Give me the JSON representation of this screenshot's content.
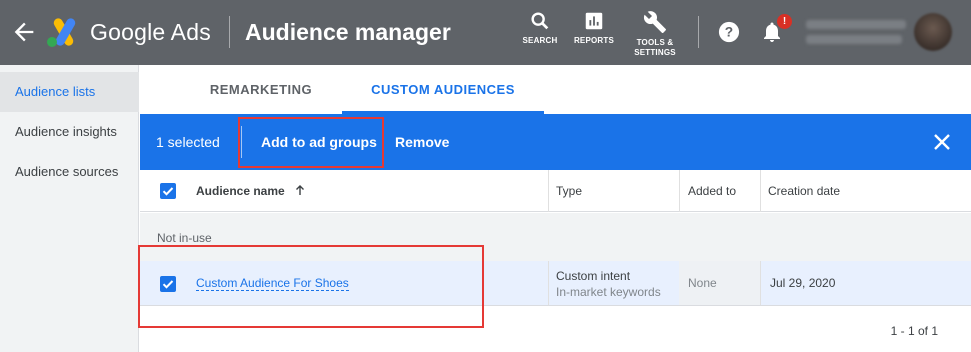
{
  "header": {
    "brand": "Google Ads",
    "page_title": "Audience manager",
    "tools": [
      {
        "icon": "search-icon",
        "label": "SEARCH"
      },
      {
        "icon": "reports-icon",
        "label": "REPORTS"
      },
      {
        "icon": "wrench-icon",
        "label_line1": "TOOLS &",
        "label_line2": "SETTINGS"
      }
    ],
    "notification_badge": "!"
  },
  "sidebar": {
    "items": [
      {
        "label": "Audience lists",
        "active": true
      },
      {
        "label": "Audience insights",
        "active": false
      },
      {
        "label": "Audience sources",
        "active": false
      }
    ]
  },
  "tabs": [
    {
      "label": "REMARKETING",
      "active": false
    },
    {
      "label": "CUSTOM AUDIENCES",
      "active": true
    }
  ],
  "selection_bar": {
    "count_text": "1 selected",
    "add_label": "Add to ad groups",
    "remove_label": "Remove"
  },
  "table": {
    "columns": {
      "name": "Audience name",
      "type": "Type",
      "added": "Added to",
      "date": "Creation date"
    },
    "group_label": "Not in-use",
    "rows": [
      {
        "name": "Custom Audience For Shoes",
        "type_main": "Custom intent",
        "type_sub": "In-market keywords",
        "added_to": "None",
        "creation_date": "Jul 29, 2020",
        "selected": true
      }
    ],
    "pagination": "1 - 1 of 1"
  },
  "colors": {
    "header_bg": "#5f6368",
    "accent": "#1a73e8",
    "highlight_box": "#e53935"
  }
}
